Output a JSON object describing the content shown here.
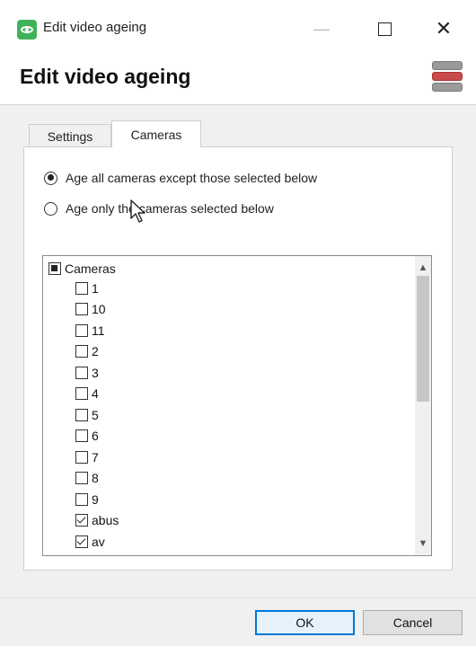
{
  "window": {
    "title": "Edit video ageing",
    "minimize_glyph": "—",
    "close_glyph": "✕"
  },
  "header": {
    "title": "Edit video ageing",
    "icon": "database-icon"
  },
  "tabs": [
    {
      "label": "Settings",
      "active": false
    },
    {
      "label": "Cameras",
      "active": true
    }
  ],
  "options": {
    "age_all_except": {
      "label": "Age all cameras except those selected below",
      "selected": true
    },
    "age_only_selected": {
      "label": "Age only the cameras selected below",
      "selected": false
    }
  },
  "camera_tree": {
    "root_label": "Cameras",
    "root_state": "partial",
    "items": [
      {
        "label": "1",
        "checked": false
      },
      {
        "label": "10",
        "checked": false
      },
      {
        "label": "11",
        "checked": false
      },
      {
        "label": "2",
        "checked": false
      },
      {
        "label": "3",
        "checked": false
      },
      {
        "label": "4",
        "checked": false
      },
      {
        "label": "5",
        "checked": false
      },
      {
        "label": "6",
        "checked": false
      },
      {
        "label": "7",
        "checked": false
      },
      {
        "label": "8",
        "checked": false
      },
      {
        "label": "9",
        "checked": false
      },
      {
        "label": "abus",
        "checked": true
      },
      {
        "label": "av",
        "checked": true
      }
    ]
  },
  "buttons": {
    "ok": "OK",
    "cancel": "Cancel"
  },
  "colors": {
    "accent": "#0078d7",
    "app_icon": "#3fb25a"
  }
}
